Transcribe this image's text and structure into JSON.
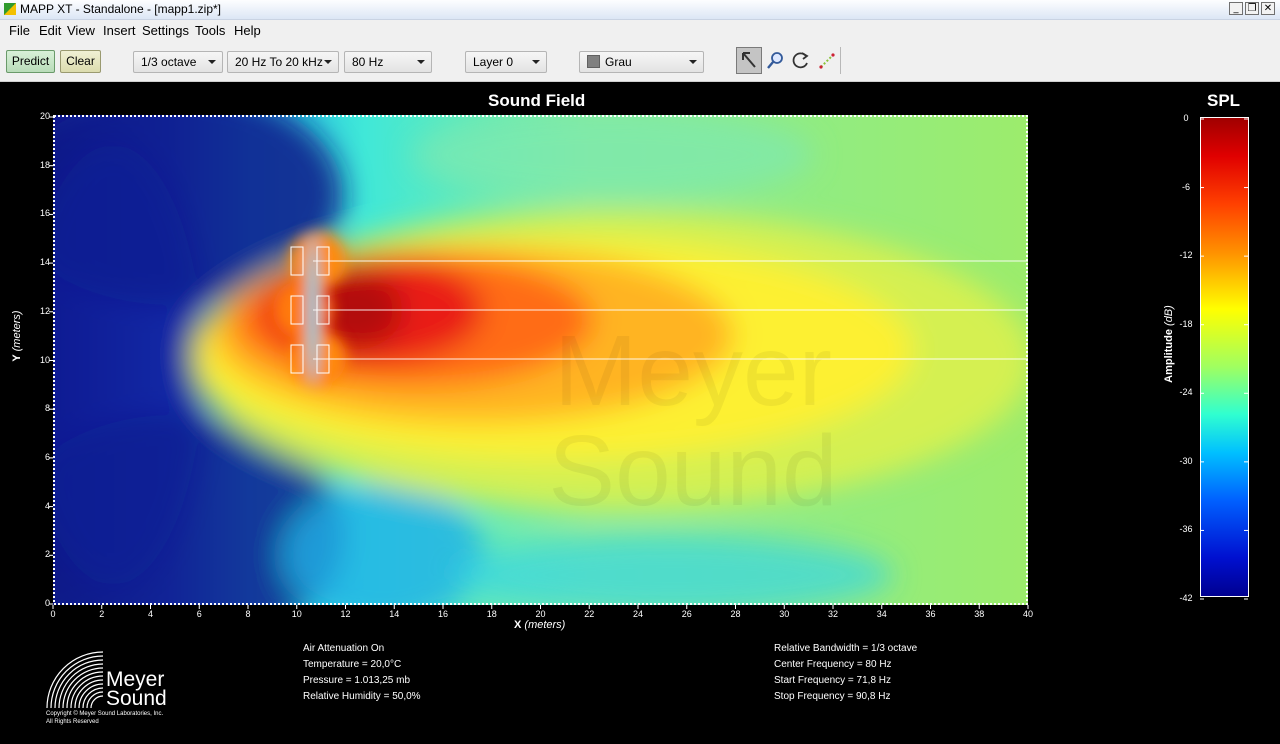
{
  "window": {
    "title": "MAPP XT - Standalone - [mapp1.zip*]",
    "min": "_",
    "restore": "❐",
    "close": "✕"
  },
  "menu": [
    {
      "label": "File"
    },
    {
      "label": "Edit"
    },
    {
      "label": "View"
    },
    {
      "label": "Insert"
    },
    {
      "label": "Settings"
    },
    {
      "label": "Tools"
    },
    {
      "label": "Help"
    }
  ],
  "toolbar": {
    "predict": "Predict",
    "clear": "Clear",
    "bandwidth": "1/3 octave",
    "range": "20 Hz To 20 kHz",
    "frequency": "80 Hz",
    "layer": "Layer 0",
    "color_scheme": "Grau",
    "tools": [
      "select-arrow-icon",
      "zoom-icon",
      "rotate-icon",
      "measure-icon"
    ]
  },
  "plot": {
    "title": "Sound Field",
    "xlabel": "X",
    "xunit": "(meters)",
    "ylabel": "Y",
    "yunit": "(meters)",
    "x_ticks": [
      "0",
      "2",
      "4",
      "6",
      "8",
      "10",
      "12",
      "14",
      "16",
      "18",
      "20",
      "22",
      "24",
      "26",
      "28",
      "30",
      "32",
      "34",
      "36",
      "38",
      "40"
    ],
    "y_ticks": [
      "20",
      "18",
      "16",
      "14",
      "12",
      "10",
      "8",
      "6",
      "4",
      "2",
      "0"
    ],
    "watermark": [
      "Meyer",
      "Sound"
    ]
  },
  "colorbar": {
    "title": "SPL",
    "label": "Amplitude",
    "unit": "(dB)",
    "ticks": [
      "0",
      "-6",
      "-12",
      "-18",
      "-24",
      "-30",
      "-36",
      "-42"
    ]
  },
  "conditions": {
    "air_attenuation": "Air Attenuation On",
    "temperature": "Temperature = 20,0°C",
    "pressure": "Pressure = 1.013,25  mb",
    "humidity": "Relative Humidity = 50,0%"
  },
  "frequency_info": {
    "bandwidth": "Relative Bandwidth = 1/3 octave",
    "center": "Center Frequency = 80 Hz",
    "start": "Start Frequency = 71,8 Hz",
    "stop": "Stop Frequency = 90,8 Hz"
  },
  "logo": {
    "line1": "Meyer",
    "line2": "Sound",
    "copyright": "Copyright © Meyer Sound Laboratories, Inc.",
    "rights": "All Rights Reserved"
  },
  "colors": {
    "toolbar_bg": "#f0f0f0",
    "predict_bg": "#c8e6c8",
    "clear_bg": "#e6e6c0"
  }
}
